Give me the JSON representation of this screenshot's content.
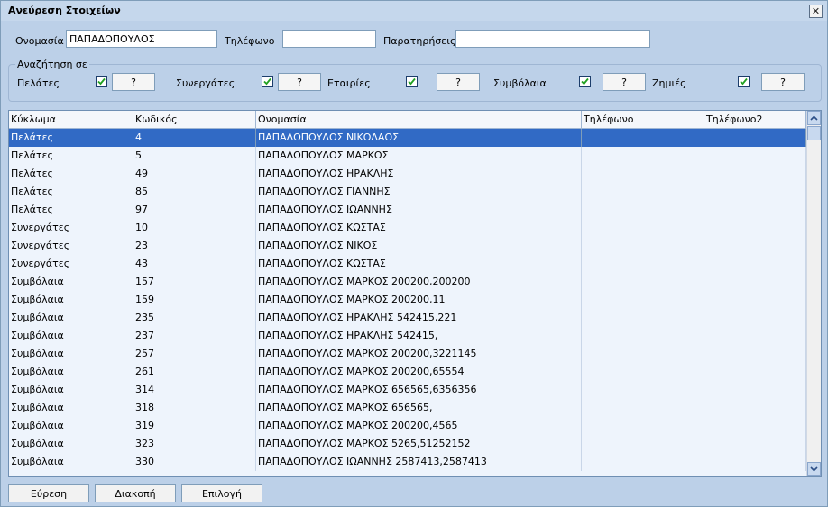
{
  "window": {
    "title": "Ανεύρεση Στοιχείων",
    "close_symbol": "✕"
  },
  "search": {
    "name_label": "Ονομασία",
    "name_value": "ΠΑΠΑΔΟΠΟΥΛΟΣ",
    "phone_label": "Τηλέφωνο",
    "phone_value": "",
    "notes_label": "Παρατηρήσεις",
    "notes_value": ""
  },
  "search_in": {
    "caption": "Αναζήτηση σε",
    "options": [
      {
        "label": "Πελάτες",
        "checked": true,
        "button": "?"
      },
      {
        "label": "Συνεργάτες",
        "checked": true,
        "button": "?"
      },
      {
        "label": "Εταιρίες",
        "checked": true,
        "button": "?"
      },
      {
        "label": "Συμβόλαια",
        "checked": true,
        "button": "?"
      },
      {
        "label": "Ζημιές",
        "checked": true,
        "button": "?"
      }
    ]
  },
  "grid": {
    "columns": [
      "Κύκλωμα",
      "Κωδικός",
      "Ονομασία",
      "Τηλέφωνο",
      "Τηλέφωνο2"
    ],
    "selected_row": 0,
    "rows": [
      [
        "Πελάτες",
        "4",
        "ΠΑΠΑΔΟΠΟΥΛΟΣ ΝΙΚΟΛΑΟΣ",
        "",
        ""
      ],
      [
        "Πελάτες",
        "5",
        "ΠΑΠΑΔΟΠΟΥΛΟΣ ΜΑΡΚΟΣ",
        "",
        ""
      ],
      [
        "Πελάτες",
        "49",
        "ΠΑΠΑΔΟΠΟΥΛΟΣ ΗΡΑΚΛΗΣ",
        "",
        ""
      ],
      [
        "Πελάτες",
        "85",
        "ΠΑΠΑΔΟΠΟΥΛΟΣ ΓΙΑΝΝΗΣ",
        "",
        ""
      ],
      [
        "Πελάτες",
        "97",
        "ΠΑΠΑΔΟΠΟΥΛΟΣ ΙΩΑΝΝΗΣ",
        "",
        ""
      ],
      [
        "Συνεργάτες",
        "10",
        "ΠΑΠΑΔΟΠΟΥΛΟΣ ΚΩΣΤΑΣ",
        "",
        ""
      ],
      [
        "Συνεργάτες",
        "23",
        "ΠΑΠΑΔΟΠΟΥΛΟΣ ΝΙΚΟΣ",
        "",
        ""
      ],
      [
        "Συνεργάτες",
        "43",
        "ΠΑΠΑΔΟΠΟΥΛΟΣ ΚΩΣΤΑΣ",
        "",
        ""
      ],
      [
        "Συμβόλαια",
        "157",
        "ΠΑΠΑΔΟΠΟΥΛΟΣ ΜΑΡΚΟΣ 200200,200200",
        "",
        ""
      ],
      [
        "Συμβόλαια",
        "159",
        "ΠΑΠΑΔΟΠΟΥΛΟΣ ΜΑΡΚΟΣ 200200,11",
        "",
        ""
      ],
      [
        "Συμβόλαια",
        "235",
        "ΠΑΠΑΔΟΠΟΥΛΟΣ ΗΡΑΚΛΗΣ 542415,221",
        "",
        ""
      ],
      [
        "Συμβόλαια",
        "237",
        "ΠΑΠΑΔΟΠΟΥΛΟΣ ΗΡΑΚΛΗΣ 542415,",
        "",
        ""
      ],
      [
        "Συμβόλαια",
        "257",
        "ΠΑΠΑΔΟΠΟΥΛΟΣ ΜΑΡΚΟΣ 200200,3221145",
        "",
        ""
      ],
      [
        "Συμβόλαια",
        "261",
        "ΠΑΠΑΔΟΠΟΥΛΟΣ ΜΑΡΚΟΣ 200200,65554",
        "",
        ""
      ],
      [
        "Συμβόλαια",
        "314",
        "ΠΑΠΑΔΟΠΟΥΛΟΣ ΜΑΡΚΟΣ 656565,6356356",
        "",
        ""
      ],
      [
        "Συμβόλαια",
        "318",
        "ΠΑΠΑΔΟΠΟΥΛΟΣ ΜΑΡΚΟΣ 656565,",
        "",
        ""
      ],
      [
        "Συμβόλαια",
        "319",
        "ΠΑΠΑΔΟΠΟΥΛΟΣ ΜΑΡΚΟΣ 200200,4565",
        "",
        ""
      ],
      [
        "Συμβόλαια",
        "323",
        "ΠΑΠΑΔΟΠΟΥΛΟΣ ΜΑΡΚΟΣ 5265,51252152",
        "",
        ""
      ],
      [
        "Συμβόλαια",
        "330",
        "ΠΑΠΑΔΟΠΟΥΛΟΣ ΙΩΑΝΝΗΣ 2587413,2587413",
        "",
        ""
      ]
    ]
  },
  "buttons": {
    "find": "Εύρεση",
    "stop": "Διακοπή",
    "select": "Επιλογή"
  },
  "colors": {
    "selection": "#316ac5",
    "background": "#bcd0e8",
    "grid_background": "#eef4fc"
  }
}
